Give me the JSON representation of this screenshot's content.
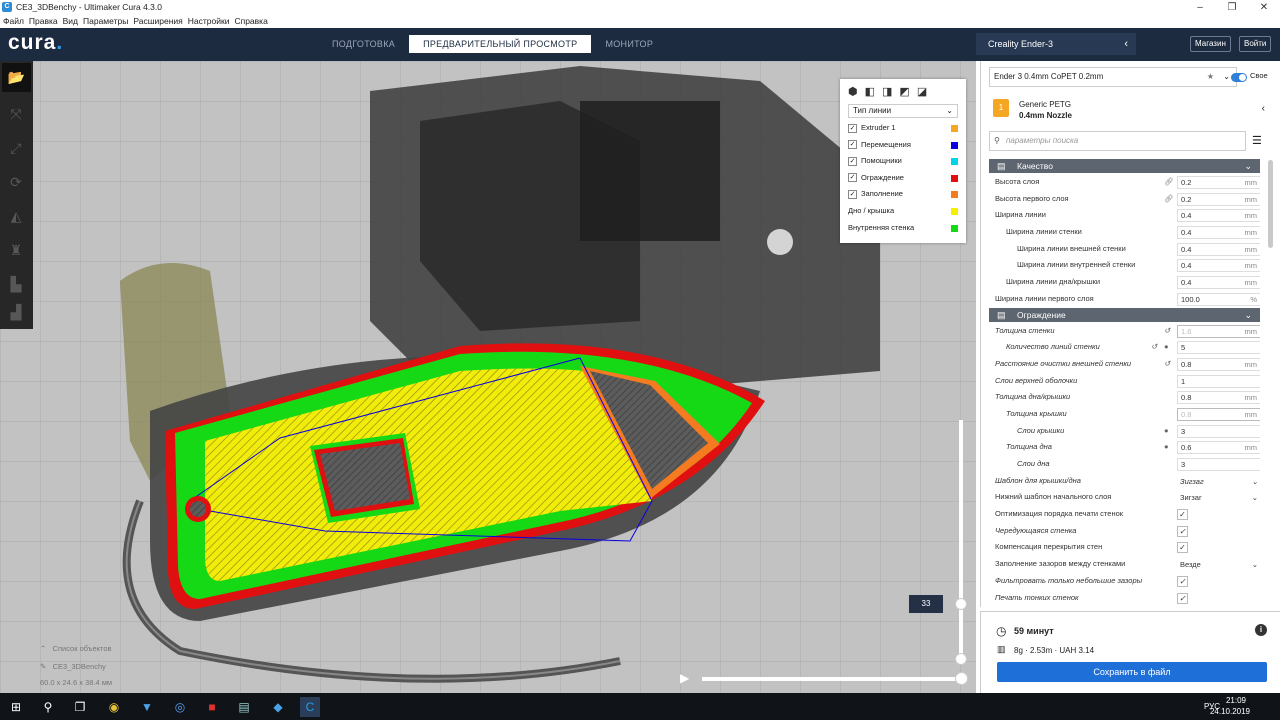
{
  "window": {
    "title": "CE3_3DBenchy - Ultimaker Cura 4.3.0",
    "controls": [
      "–",
      "❐",
      "✕"
    ]
  },
  "menu": [
    "Файл",
    "Правка",
    "Вид",
    "Параметры",
    "Расширения",
    "Настройки",
    "Справка"
  ],
  "header": {
    "logo": "cura",
    "stages": [
      "ПОДГОТОВКА",
      "ПРЕДВАРИТЕЛЬНЫЙ ПРОСМОТР",
      "МОНИТОР"
    ],
    "active_stage": "ПРЕДВАРИТЕЛЬНЫЙ ПРОСМОТР",
    "printer": "Creality Ender-3",
    "marketplace": "Магазин",
    "signin": "Войти"
  },
  "legend": {
    "view_type": "Тип линии",
    "items": [
      {
        "label": "Extruder 1",
        "checked": true,
        "color": "#f5a623"
      },
      {
        "label": "Перемещения",
        "checked": true,
        "color": "#0a00e0"
      },
      {
        "label": "Помощники",
        "checked": true,
        "color": "#00d5e8"
      },
      {
        "label": "Ограждение",
        "checked": true,
        "color": "#e01010"
      },
      {
        "label": "Заполнение",
        "checked": true,
        "color": "#f47b20"
      },
      {
        "label": "Дно / крышка",
        "checked": null,
        "color": "#f7ef00"
      },
      {
        "label": "Внутренняя стенка",
        "checked": null,
        "color": "#16d916"
      }
    ]
  },
  "object": {
    "list_label": "Список объектов",
    "name": "CE3_3DBenchy",
    "dims": "60.0 x 24.6 x 38.4 мм"
  },
  "layer": {
    "current": "33"
  },
  "profile": {
    "name": "Ender 3 0.4mm CoPET  0.2mm",
    "toggle_label": "Свое"
  },
  "material": {
    "name": "Generic PETG",
    "nozzle": "0.4mm Nozzle"
  },
  "search_placeholder": "параметры поиска",
  "categories": [
    {
      "title": "Качество",
      "settings": [
        {
          "label": "Высота слоя",
          "indent": 0,
          "value": "0.2",
          "unit": "mm",
          "link": true
        },
        {
          "label": "Высота первого слоя",
          "indent": 0,
          "value": "0.2",
          "unit": "mm",
          "link": true
        },
        {
          "label": "Ширина линии",
          "indent": 0,
          "value": "0.4",
          "unit": "mm"
        },
        {
          "label": "Ширина линии стенки",
          "indent": 1,
          "value": "0.4",
          "unit": "mm"
        },
        {
          "label": "Ширина линии внешней стенки",
          "indent": 2,
          "value": "0.4",
          "unit": "mm"
        },
        {
          "label": "Ширина линии внутренней стенки",
          "indent": 2,
          "value": "0.4",
          "unit": "mm"
        },
        {
          "label": "Ширина линии дна/крышки",
          "indent": 1,
          "value": "0.4",
          "unit": "mm"
        },
        {
          "label": "Ширина линии первого слоя",
          "indent": 0,
          "value": "100.0",
          "unit": "%"
        }
      ]
    },
    {
      "title": "Ограждение",
      "settings": [
        {
          "label": "Толщина стенки",
          "indent": 0,
          "value": "1.6",
          "unit": "mm",
          "italic": true,
          "reset": true,
          "disabled": true
        },
        {
          "label": "Количество линий стенки",
          "indent": 1,
          "value": "5",
          "unit": "",
          "italic": true,
          "reset": true,
          "info": true
        },
        {
          "label": "Расстояние очистки внешней стенки",
          "indent": 0,
          "value": "0.8",
          "unit": "mm",
          "italic": true,
          "reset": true
        },
        {
          "label": "Слои верхней оболочки",
          "indent": 0,
          "value": "1",
          "unit": "",
          "italic": true
        },
        {
          "label": "Толщина дна/крышки",
          "indent": 0,
          "value": "0.8",
          "unit": "mm",
          "italic": true
        },
        {
          "label": "Толщина крышки",
          "indent": 1,
          "value": "0.8",
          "unit": "mm",
          "italic": true,
          "disabled": true
        },
        {
          "label": "Слои крышки",
          "indent": 2,
          "value": "3",
          "unit": "",
          "italic": true,
          "info": true
        },
        {
          "label": "Толщина дна",
          "indent": 1,
          "value": "0.6",
          "unit": "mm",
          "italic": true,
          "info": true
        },
        {
          "label": "Слои дна",
          "indent": 2,
          "value": "3",
          "unit": "",
          "italic": true
        },
        {
          "label": "Шаблон для крышки/дна",
          "indent": 0,
          "dropdown": "Зигзаг",
          "italic": true
        },
        {
          "label": "Нижний шаблон начального слоя",
          "indent": 0,
          "dropdown": "Зигзаг"
        },
        {
          "label": "Оптимизация порядка печати стенок",
          "indent": 0,
          "checkbox": true
        },
        {
          "label": "Чередующаяся стенка",
          "indent": 0,
          "checkbox": true,
          "italic": true
        },
        {
          "label": "Компенсация перекрытия стен",
          "indent": 0,
          "checkbox": true
        },
        {
          "label": "Заполнение зазоров между стенками",
          "indent": 0,
          "dropdown": "Везде"
        },
        {
          "label": "Фильтровать только небольшие зазоры",
          "indent": 0,
          "checkbox": true,
          "italic": true
        },
        {
          "label": "Печать тонких стенок",
          "indent": 0,
          "checkbox": true,
          "italic": true
        }
      ]
    }
  ],
  "summary": {
    "time": "59 минут",
    "material_usage": "8g · 2.53m · UAH 3.14",
    "save": "Сохранить в файл"
  },
  "taskbar": {
    "lang": "РУС",
    "time": "21:09",
    "date": "24.10.2019"
  }
}
